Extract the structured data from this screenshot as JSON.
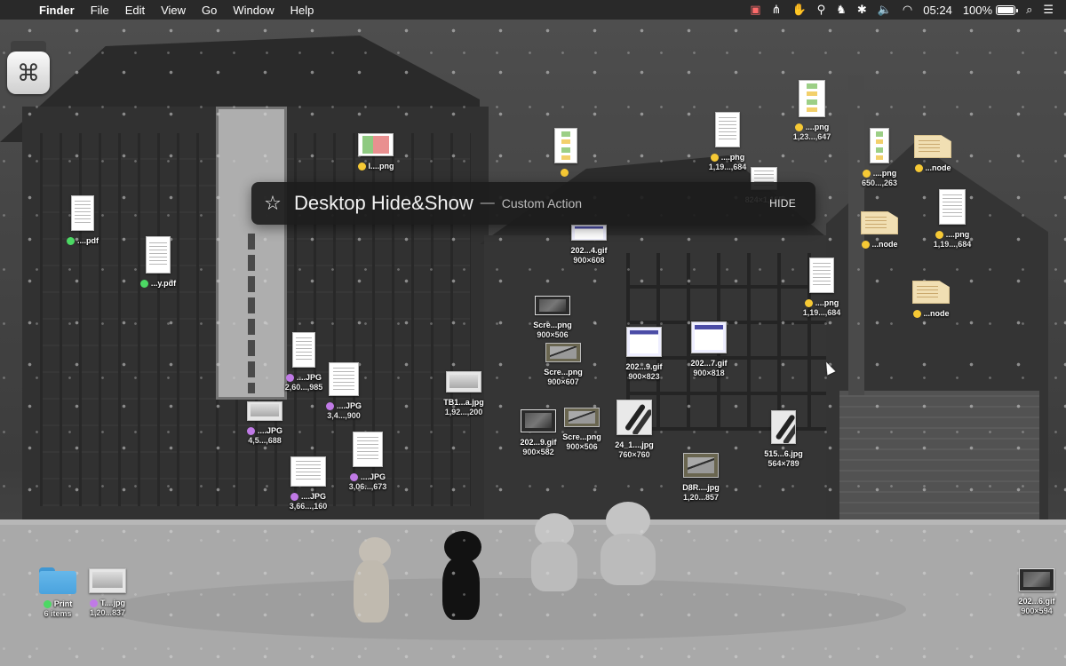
{
  "menubar": {
    "apple_icon": "apple-logo-icon",
    "app_name": "Finder",
    "menus": [
      "File",
      "Edit",
      "View",
      "Go",
      "Window",
      "Help"
    ],
    "status_icons": [
      "calendar-badge-icon",
      "pitchfork-icon",
      "hand-gesture-icon",
      "broom-icon",
      "horse-icon",
      "bluetooth-icon",
      "volume-icon",
      "wifi-icon"
    ],
    "clock": "05:24",
    "battery": "100%",
    "spotlight_icon": "search-icon",
    "notification_icon": "list-icon"
  },
  "hud": {
    "icon": "star-icon",
    "title": "Desktop Hide&Show",
    "separator": "—",
    "subtitle": "Custom Action",
    "button": "HIDE"
  },
  "desktop_items": [
    {
      "name": "I....png",
      "sub": "",
      "tag": "yellow",
      "kind": "sheet"
    },
    {
      "name": "",
      "sub": "",
      "tag": "yellow",
      "kind": "flow"
    },
    {
      "name": "....png",
      "sub": "1,19...,684",
      "tag": "yellow",
      "kind": "doc"
    },
    {
      "name": "....png",
      "sub": "1,23...,647",
      "tag": "yellow",
      "kind": "flow"
    },
    {
      "name": "....png",
      "sub": "650...,263",
      "tag": "yellow",
      "kind": "flow"
    },
    {
      "name": "...node",
      "sub": "",
      "tag": "yellow",
      "kind": "node"
    },
    {
      "name": "",
      "sub": "824×1,155",
      "tag": "",
      "kind": "doc"
    },
    {
      "name": "...node",
      "sub": "",
      "tag": "yellow",
      "kind": "node"
    },
    {
      "name": "....png",
      "sub": "1,19...,684",
      "tag": "yellow",
      "kind": "doc"
    },
    {
      "name": "....png",
      "sub": "1,19...,684",
      "tag": "yellow",
      "kind": "doc"
    },
    {
      "name": "...node",
      "sub": "",
      "tag": "yellow",
      "kind": "node"
    },
    {
      "name": "....pdf",
      "sub": "",
      "tag": "green",
      "kind": "doc"
    },
    {
      "name": "...y.pdf",
      "sub": "",
      "tag": "green",
      "kind": "doc"
    },
    {
      "name": "202...4.gif",
      "sub": "900×608",
      "tag": "",
      "kind": "gif"
    },
    {
      "name": "Scre...png",
      "sub": "900×506",
      "tag": "",
      "kind": "dark"
    },
    {
      "name": "Scre...png",
      "sub": "900×607",
      "tag": "",
      "kind": "photo"
    },
    {
      "name": "202...9.gif",
      "sub": "900×823",
      "tag": "",
      "kind": "gif"
    },
    {
      "name": "202...7.gif",
      "sub": "900×818",
      "tag": "",
      "kind": "gif"
    },
    {
      "name": "....JPG",
      "sub": "2,60...,985",
      "tag": "purple",
      "kind": "doc"
    },
    {
      "name": "....JPG",
      "sub": "3,4...,900",
      "tag": "purple",
      "kind": "doc"
    },
    {
      "name": "....JPG",
      "sub": "4,5...,688",
      "tag": "purple",
      "kind": "shot"
    },
    {
      "name": "....JPG",
      "sub": "3,06...,673",
      "tag": "purple",
      "kind": "doc"
    },
    {
      "name": "....JPG",
      "sub": "3,66...,160",
      "tag": "purple",
      "kind": "doc"
    },
    {
      "name": "TB1...a.jpg",
      "sub": "1,92...,200",
      "tag": "",
      "kind": "shot"
    },
    {
      "name": "202...9.gif",
      "sub": "900×582",
      "tag": "",
      "kind": "dark"
    },
    {
      "name": "Scre...png",
      "sub": "900×506",
      "tag": "",
      "kind": "photo"
    },
    {
      "name": "24_1....jpg",
      "sub": "760×760",
      "tag": "",
      "kind": "pen"
    },
    {
      "name": "515...6.jpg",
      "sub": "564×789",
      "tag": "",
      "kind": "pen"
    },
    {
      "name": "D8R....jpg",
      "sub": "1,20...857",
      "tag": "",
      "kind": "photo"
    },
    {
      "name": "Print",
      "sub": "6 items",
      "tag": "green",
      "kind": "folder"
    },
    {
      "name": "T....jpg",
      "sub": "1,20...837",
      "tag": "purple",
      "kind": "shot"
    },
    {
      "name": "202...6.gif",
      "sub": "900×594",
      "tag": "",
      "kind": "dark"
    }
  ],
  "tag_colors": {
    "green": "#4cd964",
    "yellow": "#f6c935",
    "purple": "#c07ae6"
  }
}
